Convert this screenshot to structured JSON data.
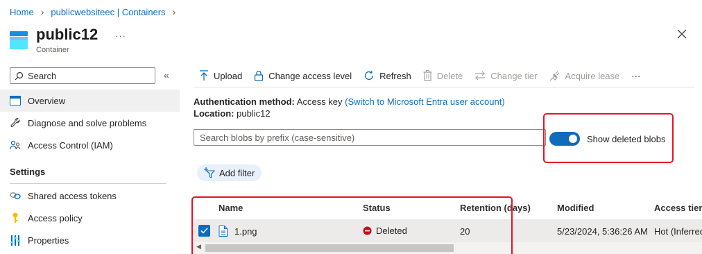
{
  "breadcrumb": {
    "items": [
      "Home",
      "publicwebsiteec | Containers"
    ]
  },
  "header": {
    "title": "public12",
    "subtitle": "Container",
    "more": "···"
  },
  "sidebar": {
    "search_placeholder": "Search",
    "collapse": "«",
    "items": [
      {
        "label": "Overview",
        "icon": "overview-icon",
        "active": true
      },
      {
        "label": "Diagnose and solve problems",
        "icon": "wrench-icon"
      },
      {
        "label": "Access Control (IAM)",
        "icon": "people-icon"
      }
    ],
    "section_settings": "Settings",
    "settings_items": [
      {
        "label": "Shared access tokens",
        "icon": "link-icon"
      },
      {
        "label": "Access policy",
        "icon": "key-icon"
      },
      {
        "label": "Properties",
        "icon": "sliders-icon"
      }
    ]
  },
  "toolbar": {
    "upload": "Upload",
    "change_access_level": "Change access level",
    "refresh": "Refresh",
    "delete": "Delete",
    "change_tier": "Change tier",
    "acquire_lease": "Acquire lease",
    "more": "···"
  },
  "info": {
    "auth_label": "Authentication method:",
    "auth_value": "Access key",
    "auth_link": "(Switch to Microsoft Entra user account)",
    "location_label": "Location:",
    "location_value": "public12"
  },
  "blob_search": {
    "placeholder": "Search blobs by prefix (case-sensitive)"
  },
  "show_deleted": {
    "label": "Show deleted blobs",
    "on": true
  },
  "filter": {
    "add_label": "Add filter"
  },
  "table": {
    "columns": [
      "Name",
      "Status",
      "Retention (days)",
      "Modified",
      "Access tier"
    ],
    "rows": [
      {
        "selected": true,
        "name": "1.png",
        "status": "Deleted",
        "retention": "20",
        "modified": "5/23/2024, 5:36:26 AM",
        "access_tier": "Hot (Inferred)"
      }
    ]
  },
  "colors": {
    "accent": "#0f6cbd",
    "deleted_status": "#c50f1f",
    "highlight_box": "#e81123"
  }
}
